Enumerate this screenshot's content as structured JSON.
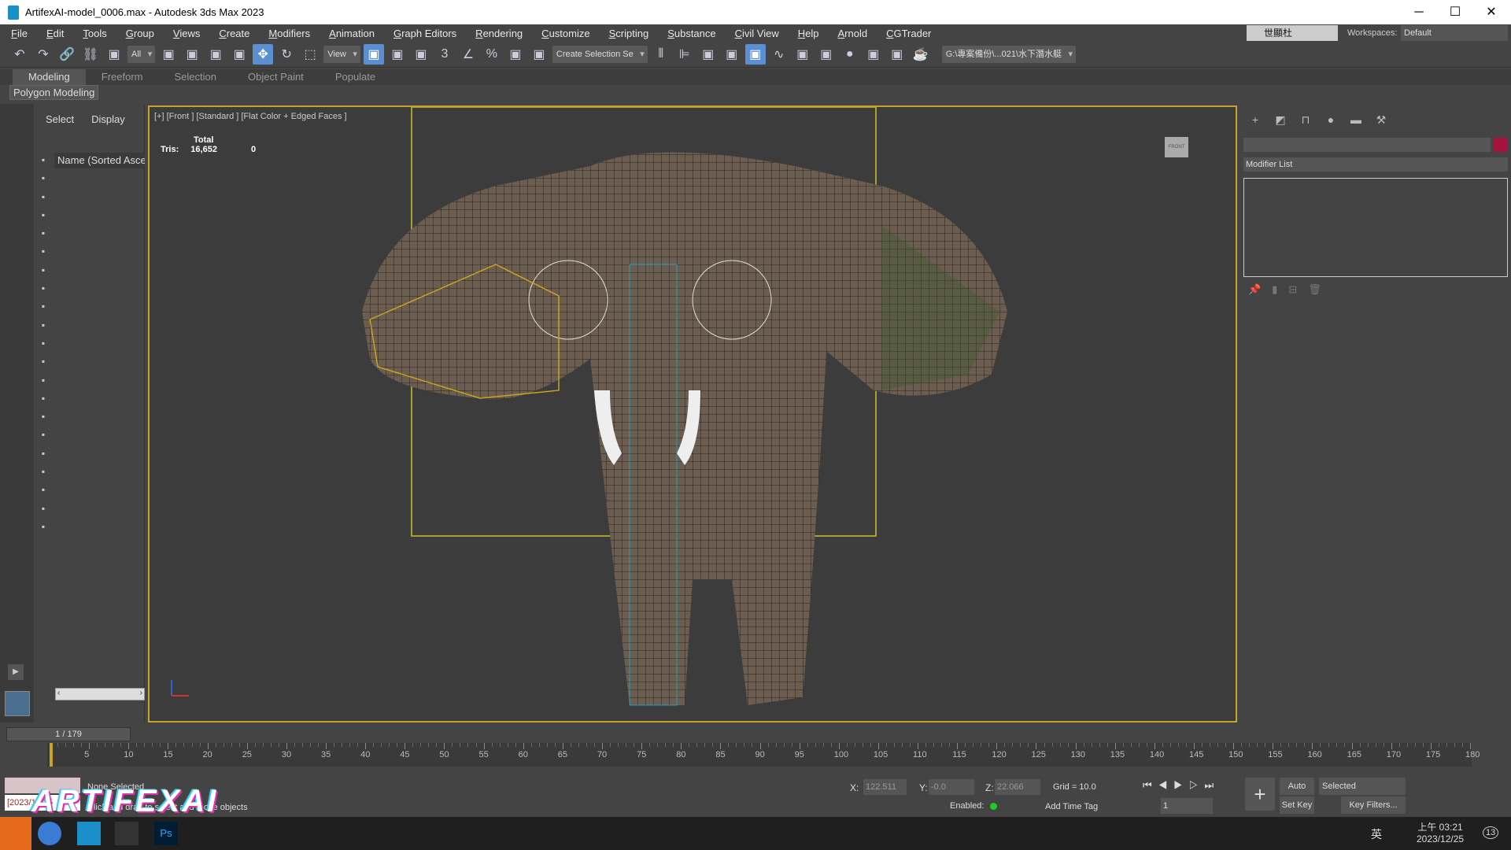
{
  "window": {
    "title": "ArtifexAI-model_0006.max - Autodesk 3ds Max 2023",
    "minimize": "─",
    "maximize": "☐",
    "close": "✕"
  },
  "menu": [
    "File",
    "Edit",
    "Tools",
    "Group",
    "Views",
    "Create",
    "Modifiers",
    "Animation",
    "Graph Editors",
    "Rendering",
    "Customize",
    "Scripting",
    "Substance",
    "Civil View",
    "Help",
    "Arnold",
    "CGTrader"
  ],
  "workspace": {
    "user": "世顯杜",
    "label": "Workspaces:",
    "value": "Default"
  },
  "toolbar": {
    "filter": "All",
    "ref_coord": "View",
    "selection_set": "Create Selection Se",
    "project_path": "G:\\專案備份\\...021\\水下潛水艇",
    "icons": [
      "undo-icon",
      "redo-icon",
      "link-icon",
      "unlink-icon",
      "bind-space-warp-icon",
      "select-object-icon",
      "select-by-name-icon",
      "rect-selection-icon",
      "window-crossing-icon",
      "move-icon",
      "rotate-icon",
      "scale-icon",
      "placement-icon",
      "pivot-icon",
      "select-manipulate-icon",
      "snap-toggle-icon",
      "angle-snap-icon",
      "percent-snap-icon",
      "spinner-snap-icon",
      "edit-named-sets-icon",
      "mirror-icon",
      "align-icon",
      "scene-explorer-icon",
      "layer-explorer-icon",
      "ribbon-icon",
      "curve-editor-icon",
      "dope-sheet-icon",
      "schematic-view-icon",
      "material-editor-icon",
      "render-setup-icon",
      "rendered-frame-icon",
      "render-icon"
    ]
  },
  "ribbon": {
    "tabs": [
      "Modeling",
      "Freeform",
      "Selection",
      "Object Paint",
      "Populate"
    ],
    "active": "Modeling",
    "panel": "Polygon Modeling"
  },
  "explorer": {
    "tabs": [
      "Select",
      "Display"
    ],
    "column": "Name (Sorted Ascending)"
  },
  "viewport": {
    "label": "[+] [Front ] [Standard ] [Flat Color + Edged Faces ]",
    "stats_header": "Total",
    "tris_label": "Tris:",
    "tris_value": "16,652",
    "tris_sel": "0",
    "viewcube": "FRONT"
  },
  "command_panel": {
    "modifier_list": "Modifier List"
  },
  "timeline": {
    "position": "1 / 179",
    "ticks": [
      5,
      10,
      15,
      20,
      25,
      30,
      35,
      40,
      45,
      50,
      55,
      60,
      65,
      70,
      75,
      80,
      85,
      90,
      95,
      100,
      105,
      110,
      115,
      120,
      125,
      130,
      135,
      140,
      145,
      150,
      155,
      160,
      165,
      170,
      175,
      180
    ]
  },
  "status": {
    "selection": "None Selected",
    "prompt": "Click and drag to select and move objects",
    "maxscript": "[2023/12/25",
    "x": "122.511",
    "y": "-0.0",
    "z": "22.066",
    "x_label": "X:",
    "y_label": "Y:",
    "z_label": "Z:",
    "grid": "Grid = 10.0",
    "enabled": "Enabled:",
    "add_time_tag": "Add Time Tag",
    "auto_key": "Auto Key",
    "set_key": "Set Key",
    "key_mode": "Selected",
    "key_filters": "Key Filters...",
    "frame": "1"
  },
  "watermark": "ArtifexAi",
  "taskbar": {
    "time": "上午 03:21",
    "date": "2023/12/25",
    "ime": "英",
    "notifications": "13"
  },
  "colors": {
    "accent": "#5b8fd1",
    "selection": "#c9a227",
    "object_color": "#a4123d"
  }
}
